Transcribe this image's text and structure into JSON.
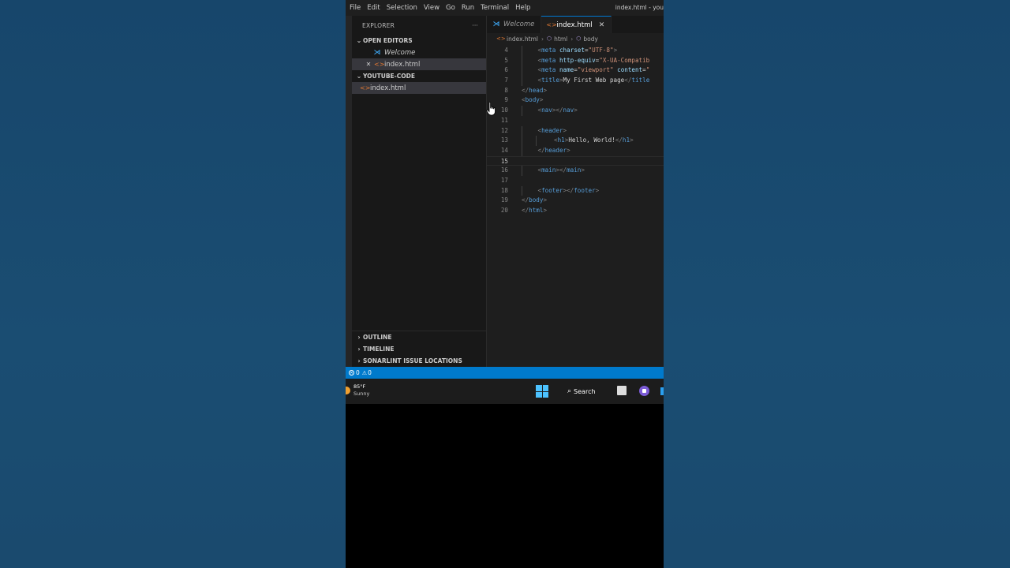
{
  "menubar": {
    "items": [
      "File",
      "Edit",
      "Selection",
      "View",
      "Go",
      "Run",
      "Terminal",
      "Help"
    ],
    "window_title": "index.html - you"
  },
  "explorer": {
    "title": "EXPLORER",
    "more": "···",
    "open_editors": {
      "label": "OPEN EDITORS",
      "items": [
        {
          "name": "Welcome"
        },
        {
          "name": "index.html"
        }
      ]
    },
    "folder": {
      "label": "YOUTUBE-CODE",
      "items": [
        {
          "name": "index.html"
        }
      ]
    },
    "bottom_sections": [
      "OUTLINE",
      "TIMELINE",
      "SONARLINT ISSUE LOCATIONS"
    ]
  },
  "editor": {
    "tabs": [
      {
        "label": "Welcome",
        "active": false
      },
      {
        "label": "index.html",
        "active": true,
        "close": "✕"
      }
    ],
    "breadcrumb": [
      "index.html",
      "html",
      "body"
    ],
    "current_line": "15",
    "lines": [
      {
        "n": "4",
        "indent": 2,
        "parts": [
          [
            "tag",
            "<"
          ],
          [
            "tn",
            "meta"
          ],
          [
            "plain",
            " "
          ],
          [
            "attr",
            "charset"
          ],
          [
            "plain",
            "="
          ],
          [
            "str",
            "\"UTF-8\""
          ],
          [
            "tag",
            ">"
          ]
        ]
      },
      {
        "n": "5",
        "indent": 2,
        "parts": [
          [
            "tag",
            "<"
          ],
          [
            "tn",
            "meta"
          ],
          [
            "plain",
            " "
          ],
          [
            "attr",
            "http-equiv"
          ],
          [
            "plain",
            "="
          ],
          [
            "str",
            "\"X-UA-Compatib"
          ]
        ]
      },
      {
        "n": "6",
        "indent": 2,
        "parts": [
          [
            "tag",
            "<"
          ],
          [
            "tn",
            "meta"
          ],
          [
            "plain",
            " "
          ],
          [
            "attr",
            "name"
          ],
          [
            "plain",
            "="
          ],
          [
            "str",
            "\"viewport\""
          ],
          [
            "plain",
            " "
          ],
          [
            "attr",
            "content"
          ],
          [
            "plain",
            "="
          ],
          [
            "str",
            "\""
          ]
        ]
      },
      {
        "n": "7",
        "indent": 2,
        "parts": [
          [
            "tag",
            "<"
          ],
          [
            "tn",
            "title"
          ],
          [
            "tag",
            ">"
          ],
          [
            "plain",
            "My First Web page"
          ],
          [
            "tag",
            "</"
          ],
          [
            "tn",
            "title"
          ]
        ]
      },
      {
        "n": "8",
        "indent": 1,
        "parts": [
          [
            "tag",
            "</"
          ],
          [
            "tn",
            "head"
          ],
          [
            "tag",
            ">"
          ]
        ]
      },
      {
        "n": "9",
        "indent": 1,
        "parts": [
          [
            "tag",
            "<"
          ],
          [
            "tn",
            "body"
          ],
          [
            "tag",
            ">"
          ]
        ]
      },
      {
        "n": "10",
        "indent": 2,
        "parts": [
          [
            "tag",
            "<"
          ],
          [
            "tn",
            "nav"
          ],
          [
            "tag",
            "></"
          ],
          [
            "tn",
            "nav"
          ],
          [
            "tag",
            ">"
          ]
        ]
      },
      {
        "n": "11",
        "indent": 0,
        "parts": []
      },
      {
        "n": "12",
        "indent": 2,
        "parts": [
          [
            "tag",
            "<"
          ],
          [
            "tn",
            "header"
          ],
          [
            "tag",
            ">"
          ]
        ]
      },
      {
        "n": "13",
        "indent": 3,
        "parts": [
          [
            "tag",
            "<"
          ],
          [
            "tn",
            "h1"
          ],
          [
            "tag",
            ">"
          ],
          [
            "plain",
            "Hello, World!"
          ],
          [
            "tag",
            "</"
          ],
          [
            "tn",
            "h1"
          ],
          [
            "tag",
            ">"
          ]
        ]
      },
      {
        "n": "14",
        "indent": 2,
        "parts": [
          [
            "tag",
            "</"
          ],
          [
            "tn",
            "header"
          ],
          [
            "tag",
            ">"
          ]
        ]
      },
      {
        "n": "15",
        "indent": 0,
        "parts": []
      },
      {
        "n": "16",
        "indent": 2,
        "parts": [
          [
            "tag",
            "<"
          ],
          [
            "tn",
            "main"
          ],
          [
            "tag",
            "></"
          ],
          [
            "tn",
            "main"
          ],
          [
            "tag",
            ">"
          ]
        ]
      },
      {
        "n": "17",
        "indent": 0,
        "parts": []
      },
      {
        "n": "18",
        "indent": 2,
        "parts": [
          [
            "tag",
            "<"
          ],
          [
            "tn",
            "footer"
          ],
          [
            "tag",
            "></"
          ],
          [
            "tn",
            "footer"
          ],
          [
            "tag",
            ">"
          ]
        ]
      },
      {
        "n": "19",
        "indent": 1,
        "parts": [
          [
            "tag",
            "</"
          ],
          [
            "tn",
            "body"
          ],
          [
            "tag",
            ">"
          ]
        ]
      },
      {
        "n": "20",
        "indent": 1,
        "parts": [
          [
            "tag",
            "</"
          ],
          [
            "tn",
            "html"
          ],
          [
            "tag",
            ">"
          ]
        ]
      }
    ]
  },
  "statusbar": {
    "errors": "0",
    "warnings": "0"
  },
  "taskbar": {
    "temperature": "85°F",
    "condition": "Sunny",
    "search_label": "Search"
  },
  "colors": {
    "accent": "#007acc",
    "html_icon": "#e37933",
    "vscode_icon": "#3b9fe8"
  }
}
